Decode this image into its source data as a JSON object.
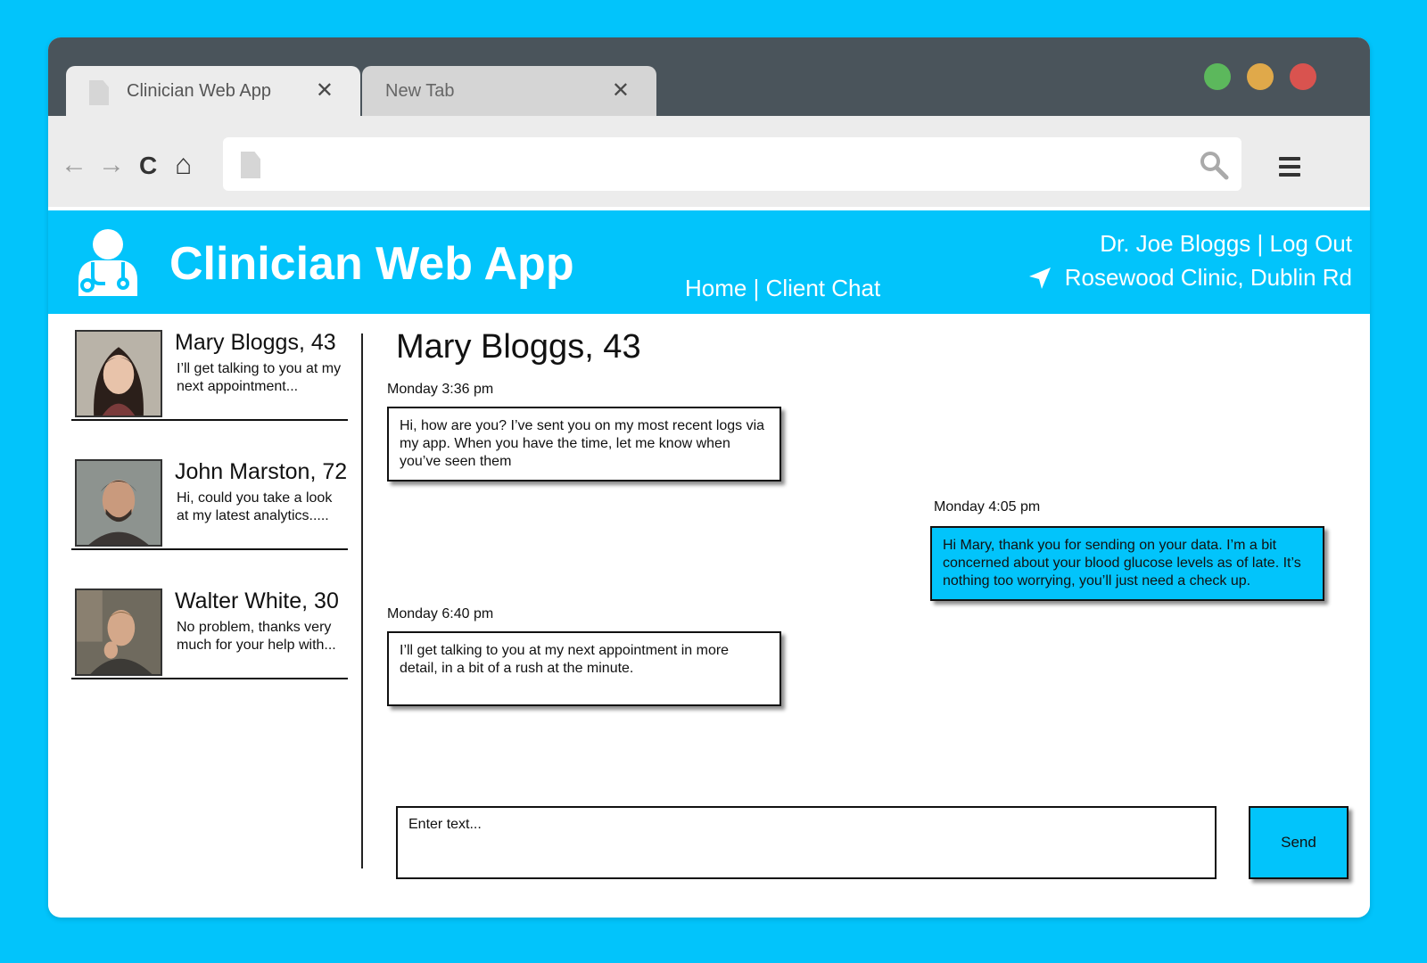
{
  "browser": {
    "tabs": [
      {
        "title": "Clinician Web App",
        "close": "✕"
      },
      {
        "title": "New Tab",
        "close": "✕"
      }
    ],
    "window_buttons": {
      "green": "#5cb85c",
      "yellow": "#e0a94a",
      "red": "#d9534f"
    },
    "nav_icons": {
      "back": "←",
      "forward": "→",
      "reload": "C",
      "home": "⌂"
    },
    "address": ""
  },
  "app": {
    "title": "Clinician Web App",
    "nav": {
      "home": "Home",
      "separator": " | ",
      "client_chat": "Client Chat"
    },
    "user": {
      "name": "Dr. Joe Bloggs",
      "separator": " | ",
      "logout": "Log Out"
    },
    "clinic": "Rosewood Clinic, Dublin Rd",
    "accent": "#02c4fb"
  },
  "contacts": [
    {
      "name": "Mary Bloggs, 43",
      "preview": "I’ll get talking to you at my next appointment..."
    },
    {
      "name": "John Marston, 72",
      "preview": "Hi, could you take a look at my latest analytics....."
    },
    {
      "name": "Walter White, 30",
      "preview": "No problem, thanks very much for your help with..."
    }
  ],
  "chat": {
    "title": "Mary Bloggs, 43",
    "messages": [
      {
        "time": "Monday 3:36 pm",
        "text": "Hi, how are you? I’ve sent you on my most recent logs via my app. When you have the time, let me know when you’ve seen them",
        "direction": "incoming"
      },
      {
        "time": "Monday 4:05 pm",
        "text": "Hi Mary, thank you for sending on your data. I’m a bit concerned about your blood glucose levels as of late. It’s nothing too worrying, you’ll just need a check up.",
        "direction": "outgoing"
      },
      {
        "time": "Monday 6:40 pm",
        "text": "I’ll get talking to you at my next appointment in more detail, in a bit of a rush at the minute.",
        "direction": "incoming"
      }
    ],
    "input_placeholder": "Enter text...",
    "send_label": "Send"
  }
}
